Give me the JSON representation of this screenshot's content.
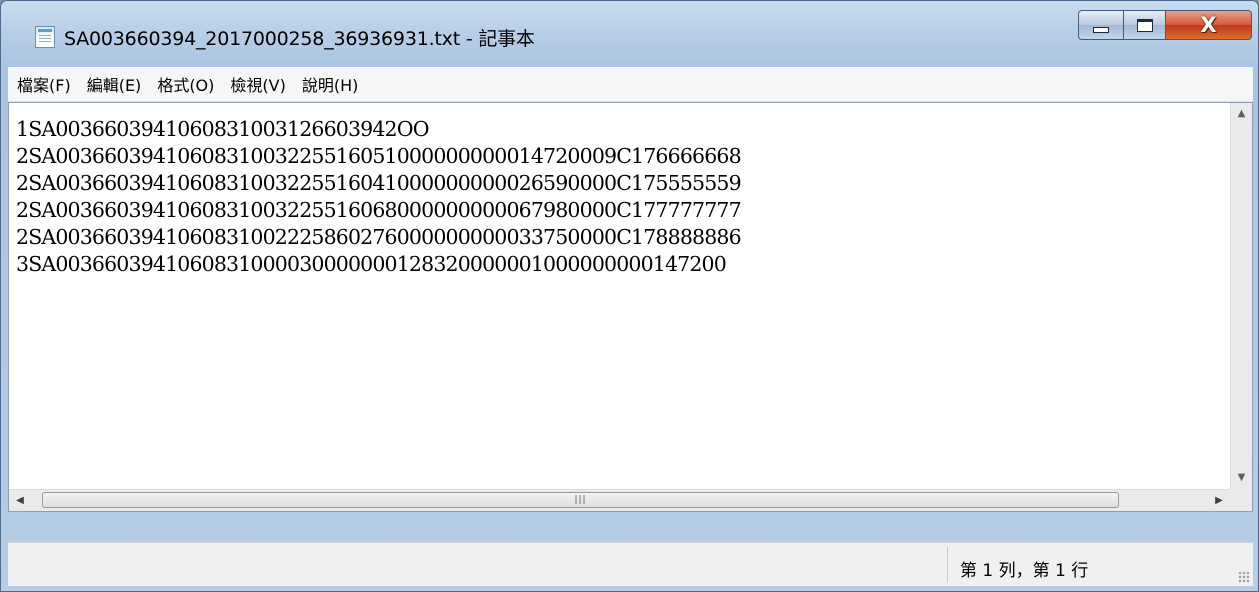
{
  "window": {
    "title": "SA003660394_2017000258_36936931.txt - 記事本",
    "icon": "notepad-icon",
    "controls": {
      "minimize_icon": "minimize-icon",
      "maximize_icon": "maximize-icon",
      "close_label": "X"
    }
  },
  "menu": {
    "items": [
      {
        "label": "檔案(F)"
      },
      {
        "label": "編輯(E)"
      },
      {
        "label": "格式(O)"
      },
      {
        "label": "檢視(V)"
      },
      {
        "label": "說明(H)"
      }
    ]
  },
  "editor": {
    "lines": [
      "1SA0036603941060831003126603942OO",
      "2SA0036603941060831003225516051000000000014720009C176666668",
      "2SA0036603941060831003225516041000000000026590000C175555559",
      "2SA0036603941060831003225516068000000000067980000C177777777",
      "2SA0036603941060831002225860276000000000033750000C178888886",
      "3SA0036603941060831000030000000128320000001000000000147200"
    ]
  },
  "scrollbars": {
    "up_arrow": "▲",
    "down_arrow": "▼",
    "left_arrow": "◀",
    "right_arrow": "▶",
    "grip": "|||"
  },
  "statusbar": {
    "position_text": "第 1 列，第 1 行"
  }
}
